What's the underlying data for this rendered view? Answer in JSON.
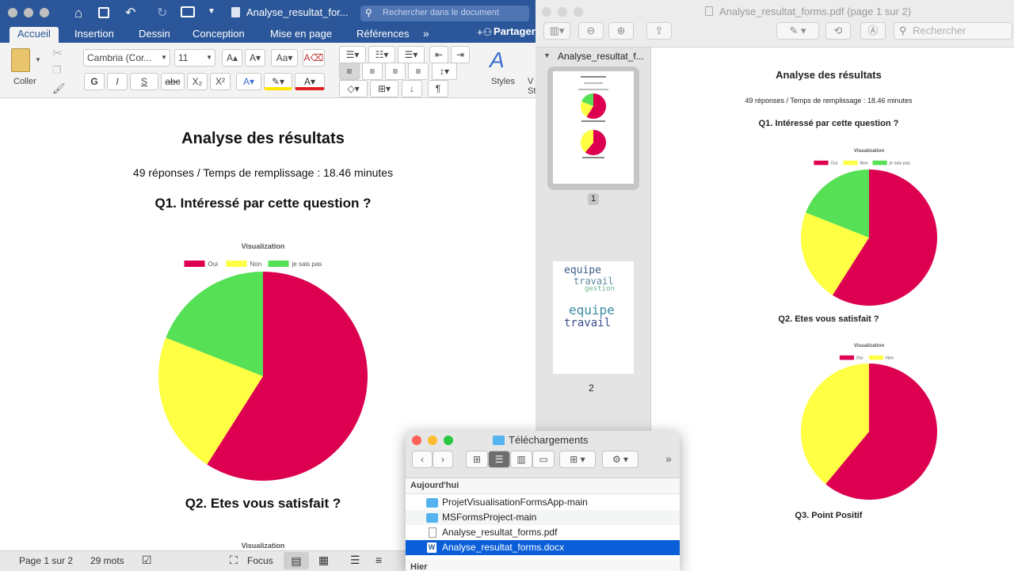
{
  "word": {
    "title": "Analyse_resultat_for...",
    "search_placeholder": "Rechercher dans le document",
    "tabs": [
      "Accueil",
      "Insertion",
      "Dessin",
      "Conception",
      "Mise en page",
      "Références"
    ],
    "share_label": "Partager",
    "ribbon": {
      "paste_label": "Coller",
      "font_name": "Cambria (Cor...",
      "font_size": "11",
      "bold": "G",
      "italic": "I",
      "underline": "S",
      "strike": "abc",
      "subscript": "X₂",
      "superscript": "X²",
      "styles_label": "Styles",
      "extra_label": "V St"
    },
    "doc": {
      "title": "Analyse des résultats",
      "subtitle": "49 réponses / Temps de remplissage : 18.46 minutes",
      "q1": "Q1. Intéressé par cette question ?",
      "q2": "Q2. Etes vous satisfait ?",
      "chart_title": "Visualization"
    },
    "status": {
      "page": "Page 1 sur 2",
      "words": "29 mots",
      "focus": "Focus"
    }
  },
  "preview": {
    "title": "Analyse_resultat_forms.pdf (page 1 sur 2)",
    "search_placeholder": "Rechercher",
    "sidebar_title": "Analyse_resultat_f...",
    "page_numbers": [
      "1",
      "2"
    ],
    "wordcloud_words": [
      "equipe",
      "travail",
      "gestion",
      "equipe",
      "travail"
    ],
    "doc": {
      "title": "Analyse des résultats",
      "subtitle": "49 réponses / Temps de remplissage : 18.46 minutes",
      "q1": "Q1. Intéressé par cette question ?",
      "q2": "Q2. Etes vous satisfait ?",
      "q3": "Q3. Point Positif",
      "chart_title": "Visualization"
    }
  },
  "finder": {
    "title": "Téléchargements",
    "section_today": "Aujourd'hui",
    "section_yesterday": "Hier",
    "files": [
      {
        "name": "ProjetVisualisationFormsApp-main",
        "kind": "folder"
      },
      {
        "name": "MSFormsProject-main",
        "kind": "folder"
      },
      {
        "name": "Analyse_resultat_forms.pdf",
        "kind": "pdf"
      },
      {
        "name": "Analyse_resultat_forms.docx",
        "kind": "docx",
        "selected": true
      }
    ]
  },
  "colors": {
    "oui": "#dd0050",
    "non": "#ffff44",
    "je_sais_pas": "#55e055",
    "word_blue": "#2b579a"
  },
  "chart_data": [
    {
      "type": "pie",
      "title": "Visualization",
      "categories": [
        "Oui",
        "Non",
        "je sais pas"
      ],
      "values": [
        59,
        22,
        19
      ],
      "legend": "top"
    },
    {
      "type": "pie",
      "title": "Visualization",
      "categories": [
        "Oui",
        "Non"
      ],
      "values": [
        61,
        39
      ],
      "legend": "top"
    }
  ]
}
